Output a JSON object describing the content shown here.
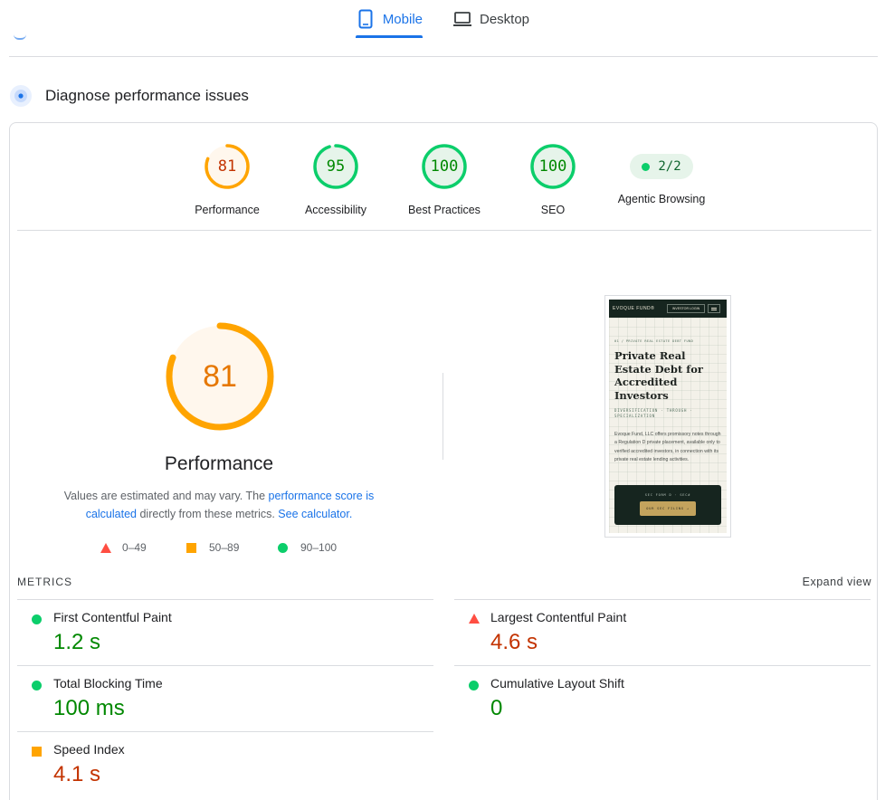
{
  "tabs": [
    {
      "label": "Mobile",
      "active": true,
      "icon": "smartphone-icon"
    },
    {
      "label": "Desktop",
      "active": false,
      "icon": "laptop-icon"
    }
  ],
  "section": {
    "title": "Diagnose performance issues",
    "icon": "diagnose-icon"
  },
  "scores": [
    {
      "label": "Performance",
      "value": "81",
      "score": 81,
      "color": "#ffa400",
      "text_color": "#c33300",
      "bg": "#fff7ed"
    },
    {
      "label": "Accessibility",
      "value": "95",
      "score": 95,
      "color": "#0cce6b",
      "text_color": "#008800",
      "bg": "#e6f4ea"
    },
    {
      "label": "Best Practices",
      "value": "100",
      "score": 100,
      "color": "#0cce6b",
      "text_color": "#008800",
      "bg": "#e6f4ea"
    },
    {
      "label": "SEO",
      "value": "100",
      "score": 100,
      "color": "#0cce6b",
      "text_color": "#008800",
      "bg": "#e6f4ea"
    }
  ],
  "agentic": {
    "label": "Agentic Browsing",
    "value": "2/2"
  },
  "performance": {
    "score": "81",
    "score_value": 81,
    "title": "Performance",
    "desc_pre": "Values are estimated and may vary. The ",
    "desc_link1": "performance score is calculated",
    "desc_mid": " directly from these metrics. ",
    "desc_link2": "See calculator.",
    "legend": [
      {
        "range": "0–49",
        "shape": "triangle",
        "color": "#ff4e42"
      },
      {
        "range": "50–89",
        "shape": "square",
        "color": "#ffa400"
      },
      {
        "range": "90–100",
        "shape": "circle",
        "color": "#0cce6b"
      }
    ]
  },
  "preview": {
    "logo": "EVOQUE FUND®",
    "nav_button": "INVESTOR LOGIN",
    "crumb": "01 / PRIVATE REAL ESTATE DEBT FUND",
    "heading": "Private Real Estate Debt for Accredited Investors",
    "subheading": "DIVERSIFICATION · THROUGH · SPECIALIZATION",
    "body": "Evoque Fund, LLC offers promissory notes through a Regulation D private placement, available only to verified accredited investors, in connection with its private real estate lending activities.",
    "cta_label": "SEC FORM D · SEC#",
    "cta_button": "OUR SEC FILING →"
  },
  "metrics": {
    "title": "METRICS",
    "expand": "Expand view",
    "items": [
      {
        "name": "First Contentful Paint",
        "value": "1.2 s",
        "rating": "good"
      },
      {
        "name": "Largest Contentful Paint",
        "value": "4.6 s",
        "rating": "bad"
      },
      {
        "name": "Total Blocking Time",
        "value": "100 ms",
        "rating": "good"
      },
      {
        "name": "Cumulative Layout Shift",
        "value": "0",
        "rating": "good"
      },
      {
        "name": "Speed Index",
        "value": "4.1 s",
        "rating": "average"
      }
    ]
  }
}
